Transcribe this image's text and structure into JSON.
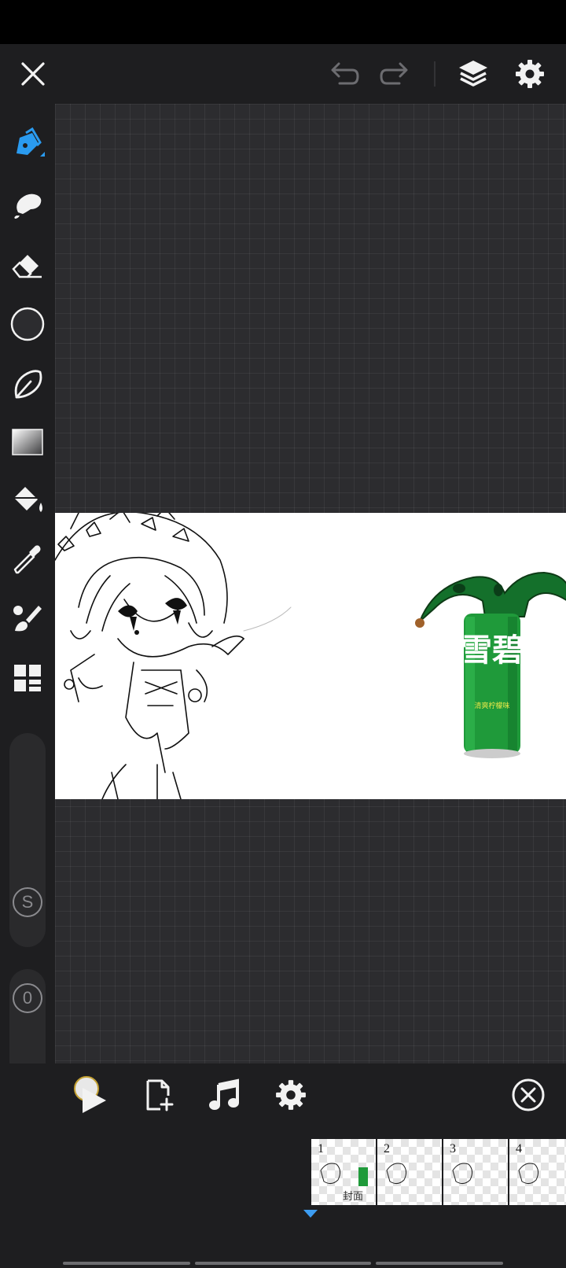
{
  "colors": {
    "accent": "#2a9bf0",
    "icon": "#f2f2f2",
    "icon_dim": "#6c6c70",
    "toolbar_bg": "#1e1e20",
    "workspace_bg": "#2c2c2f",
    "bottle_green": "#1f9a3a"
  },
  "top_bar": {
    "close_icon": "close-icon",
    "undo_icon": "undo-icon",
    "redo_icon": "redo-icon",
    "layers_icon": "layers-icon",
    "settings_icon": "gear-icon"
  },
  "tools": [
    {
      "name": "pen",
      "icon": "pen-icon",
      "active": true
    },
    {
      "name": "smudge",
      "icon": "smudge-icon"
    },
    {
      "name": "eraser",
      "icon": "eraser-icon"
    },
    {
      "name": "color",
      "icon": "color-circle-icon"
    },
    {
      "name": "lasso",
      "icon": "lasso-icon"
    },
    {
      "name": "gradient",
      "icon": "gradient-icon"
    },
    {
      "name": "fill",
      "icon": "paint-bucket-icon"
    },
    {
      "name": "eyedropper",
      "icon": "eyedropper-icon"
    },
    {
      "name": "brush-settings",
      "icon": "brush-icon"
    },
    {
      "name": "more",
      "icon": "grid-icon"
    }
  ],
  "sliders": {
    "size_label": "S",
    "opacity_label": "0"
  },
  "canvas": {
    "bottle_text": "雪碧",
    "bottle_subtext": "清爽柠檬味"
  },
  "animation": {
    "play_icon": "play-icon",
    "add_frame_icon": "add-frame-icon",
    "music_icon": "music-icon",
    "settings_icon": "gear-icon",
    "close_icon": "close-circle-icon",
    "frames": [
      {
        "number": "1",
        "caption": "封面"
      },
      {
        "number": "2"
      },
      {
        "number": "3"
      },
      {
        "number": "4"
      }
    ]
  }
}
